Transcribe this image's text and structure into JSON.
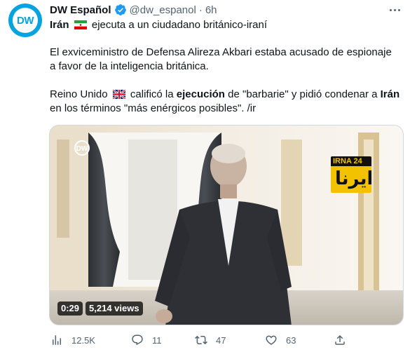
{
  "author": {
    "display_name": "DW Español",
    "handle": "@dw_espanol",
    "separator": "·",
    "time": "6h",
    "avatar_text": "DW"
  },
  "tweet": {
    "line1_bold": "Irán",
    "line1_rest": "ejecuta a un ciudadano británico-iraní",
    "para2": "El exviceministro de Defensa Alireza Akbari estaba acusado de espionaje a favor de la inteligencia británica.",
    "para3_a": "Reino Unido",
    "para3_b": "calificó la",
    "para3_bold1": "ejecución",
    "para3_c": "de \"barbarie\" y pidió condenar a",
    "para3_bold2": "Irán",
    "para3_d": "en los términos \"más enérgicos posibles\". /ir"
  },
  "media": {
    "watermark": "DW",
    "channel_logo_top": "IRNA 24",
    "channel_logo_bottom": "ايرنا",
    "duration": "0:29",
    "views": "5,214 views"
  },
  "actions": {
    "views_count": "12.5K",
    "replies_count": "11",
    "retweets_count": "47",
    "likes_count": "63"
  },
  "colors": {
    "accent": "#1d9bf0",
    "dw_blue": "#05a3e0",
    "secondary_text": "#536471"
  }
}
